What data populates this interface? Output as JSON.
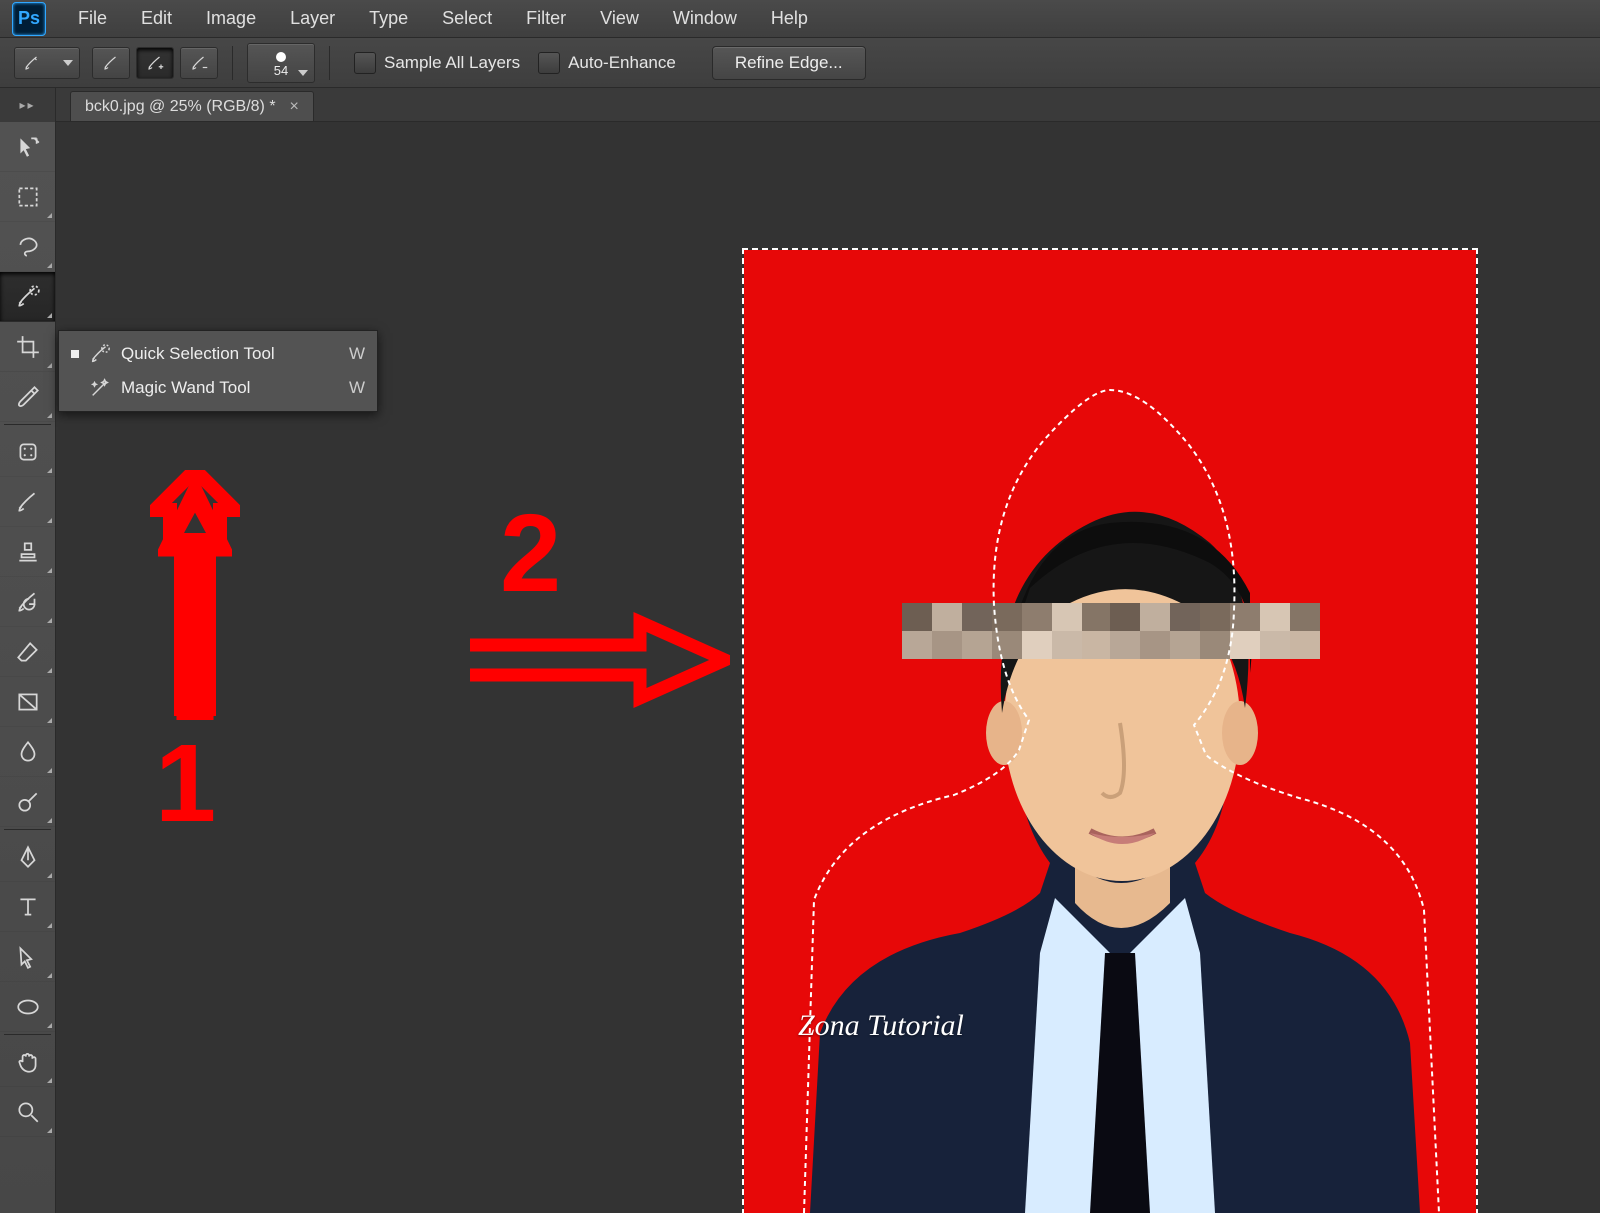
{
  "app": {
    "logo_text": "Ps"
  },
  "menu": [
    "File",
    "Edit",
    "Image",
    "Layer",
    "Type",
    "Select",
    "Filter",
    "View",
    "Window",
    "Help"
  ],
  "options": {
    "brush_size": "54",
    "sample_all_layers": "Sample All Layers",
    "auto_enhance": "Auto-Enhance",
    "refine_edge": "Refine Edge..."
  },
  "doc_tab": {
    "title": "bck0.jpg @ 25% (RGB/8) *"
  },
  "flyout": {
    "items": [
      {
        "label": "Quick Selection Tool",
        "key": "W",
        "selected": true,
        "icon": "brush"
      },
      {
        "label": "Magic Wand Tool",
        "key": "W",
        "selected": false,
        "icon": "wand"
      }
    ]
  },
  "tool_icons": [
    "move",
    "marquee",
    "lasso",
    "quick-select",
    "crop",
    "eyedropper",
    "heal",
    "brush",
    "stamp",
    "history",
    "eraser",
    "bucket",
    "blur",
    "dodge",
    "pen",
    "type",
    "path",
    "shape",
    "hand",
    "zoom"
  ],
  "annotations": {
    "one": "1",
    "two": "2"
  },
  "canvas": {
    "bg_color": "#e70808",
    "watermark": "Zona Tutorial"
  }
}
